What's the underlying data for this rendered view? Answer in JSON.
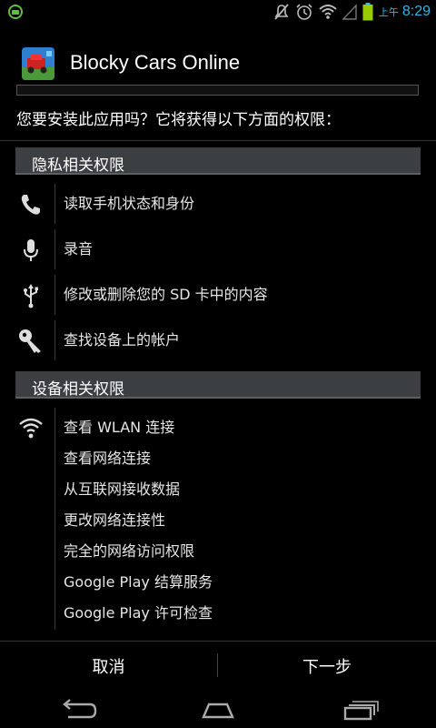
{
  "status_bar": {
    "time": "8:29",
    "ampm": "上午",
    "icons": [
      "android-notification-icon",
      "mute-icon",
      "alarm-icon",
      "wifi-icon",
      "no-signal-icon",
      "battery-icon"
    ],
    "accent": "#33b5e5"
  },
  "app": {
    "name": "Blocky Cars Online",
    "icon": "app-icon"
  },
  "install": {
    "question": "您要安装此应用吗？它将获得以下方面的权限："
  },
  "sections": [
    {
      "title": "隐私相关权限",
      "groups": [
        {
          "icon": "phone-icon",
          "items": [
            "读取手机状态和身份"
          ]
        },
        {
          "icon": "microphone-icon",
          "items": [
            "录音"
          ]
        },
        {
          "icon": "usb-icon",
          "items": [
            "修改或删除您的 SD 卡中的内容"
          ]
        },
        {
          "icon": "key-icon",
          "items": [
            "查找设备上的帐户"
          ]
        }
      ]
    },
    {
      "title": "设备相关权限",
      "groups": [
        {
          "icon": "wifi-icon",
          "items": [
            "查看 WLAN 连接",
            "查看网络连接",
            "从互联网接收数据",
            "更改网络连接性",
            "完全的网络访问权限",
            "Google Play 结算服务",
            "Google Play 许可检查"
          ]
        }
      ]
    }
  ],
  "buttons": {
    "cancel": "取消",
    "next": "下一步"
  },
  "nav": [
    "back-icon",
    "home-icon",
    "recent-apps-icon"
  ]
}
